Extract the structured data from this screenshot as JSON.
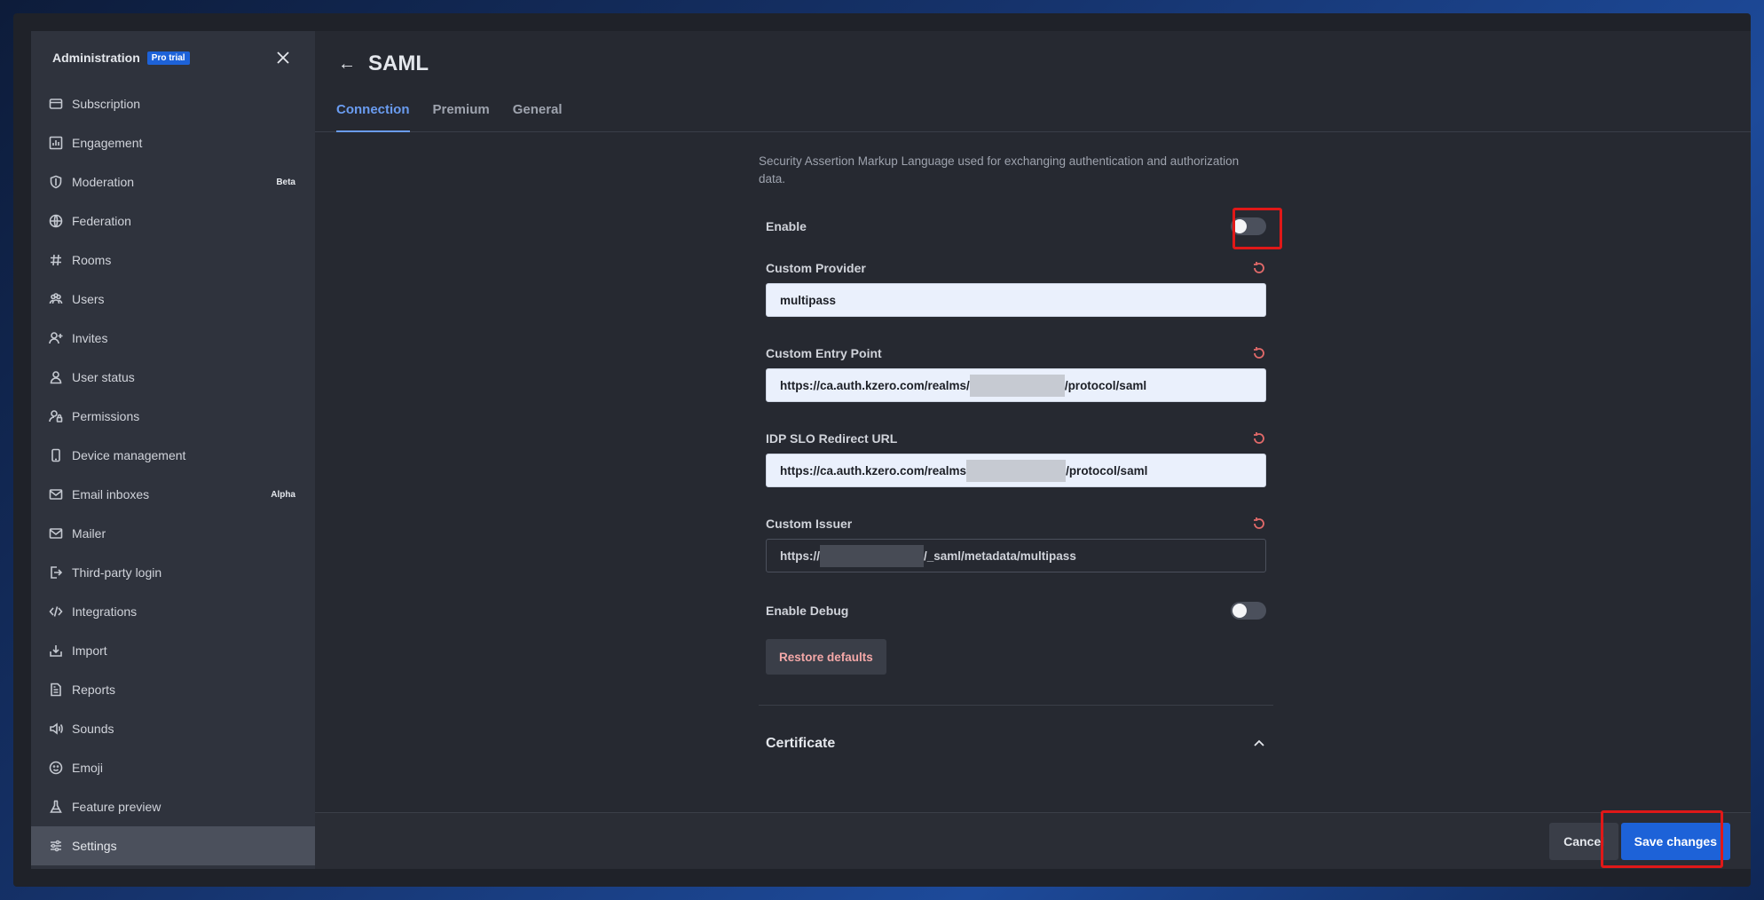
{
  "sidebar": {
    "title": "Administration",
    "badge": "Pro trial",
    "items": [
      {
        "label": "Subscription",
        "icon": "credit-card-icon"
      },
      {
        "label": "Engagement",
        "icon": "bar-chart-icon"
      },
      {
        "label": "Moderation",
        "icon": "shield-icon",
        "badge": "Beta"
      },
      {
        "label": "Federation",
        "icon": "globe-icon"
      },
      {
        "label": "Rooms",
        "icon": "hashtag-icon"
      },
      {
        "label": "Users",
        "icon": "team-icon"
      },
      {
        "label": "Invites",
        "icon": "user-plus-icon"
      },
      {
        "label": "User status",
        "icon": "user-icon"
      },
      {
        "label": "Permissions",
        "icon": "user-lock-icon"
      },
      {
        "label": "Device management",
        "icon": "mobile-icon"
      },
      {
        "label": "Email inboxes",
        "icon": "mail-icon",
        "badge": "Alpha"
      },
      {
        "label": "Mailer",
        "icon": "mail-icon"
      },
      {
        "label": "Third-party login",
        "icon": "login-icon"
      },
      {
        "label": "Integrations",
        "icon": "code-icon"
      },
      {
        "label": "Import",
        "icon": "download-icon"
      },
      {
        "label": "Reports",
        "icon": "document-icon"
      },
      {
        "label": "Sounds",
        "icon": "volume-icon"
      },
      {
        "label": "Emoji",
        "icon": "emoji-icon"
      },
      {
        "label": "Feature preview",
        "icon": "flask-icon"
      },
      {
        "label": "Settings",
        "icon": "sliders-icon",
        "active": true
      }
    ]
  },
  "page": {
    "title": "SAML",
    "tabs": [
      "Connection",
      "Premium",
      "General"
    ],
    "active_tab": "Connection"
  },
  "form": {
    "description": "Security Assertion Markup Language used for exchanging authentication and authorization data.",
    "enable_label": "Enable",
    "enable_value": false,
    "custom_provider_label": "Custom Provider",
    "custom_provider_value": "multipass",
    "custom_entry_point_label": "Custom Entry Point",
    "custom_entry_point_prefix": "https://ca.auth.kzero.com/realms/",
    "custom_entry_point_suffix": "/protocol/saml",
    "idp_slo_label": "IDP SLO Redirect URL",
    "idp_slo_prefix": "https://ca.auth.kzero.com/realms",
    "idp_slo_suffix": "/protocol/saml",
    "custom_issuer_label": "Custom Issuer",
    "custom_issuer_prefix": "https://",
    "custom_issuer_suffix": "/_saml/metadata/multipass",
    "enable_debug_label": "Enable Debug",
    "enable_debug_value": false,
    "restore_defaults_label": "Restore defaults",
    "certificate_label": "Certificate"
  },
  "footer": {
    "cancel_label": "Cancel",
    "save_label": "Save changes"
  },
  "colors": {
    "accent": "#1d62d8",
    "tab_active": "#6a9cf0",
    "highlight": "#e01818",
    "reset": "#e36a6a"
  }
}
